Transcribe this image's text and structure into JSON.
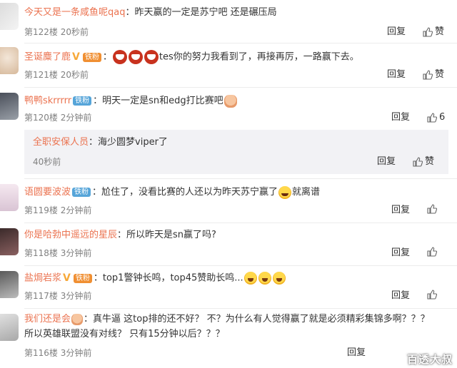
{
  "actions": {
    "reply": "回复",
    "like": "赞"
  },
  "comments": [
    {
      "user": "今天又是一条咸鱼呢qaq",
      "text": "昨天赢的一定是苏宁吧 还是碾压局",
      "floor": "第122楼",
      "time": "20秒前",
      "likes": ""
    },
    {
      "user": "圣诞麋了鹿",
      "badge": "铁粉",
      "text": "tes你的努力我看到了，再接再厉，一路赢下去。",
      "floor": "第121楼",
      "time": "20秒前",
      "likes": ""
    },
    {
      "user": "鸭鸭skrrrrr",
      "badge": "铁粉",
      "text": "明天一定是sn和edg打比赛吧",
      "floor": "第120楼",
      "time": "2分钟前",
      "likes": "6"
    },
    {
      "user": "语圆要波波",
      "badge": "铁粉",
      "text": "尬住了，没看比赛的人还以为昨天苏宁赢了",
      "text2": "就离谱",
      "floor": "第119楼",
      "time": "2分钟前",
      "likes": ""
    },
    {
      "user": "你是哈勃中遥远的星辰",
      "text": "所以昨天是sn赢了吗?",
      "floor": "第118楼",
      "time": "3分钟前",
      "likes": ""
    },
    {
      "user": "盐焗岩浆",
      "badge": "铁粉",
      "text": "top1警钟长鸣，top45赞助长鸣...",
      "floor": "第117楼",
      "time": "3分钟前",
      "likes": ""
    },
    {
      "user": "我们还是会",
      "text": "真牛逼 这top排的还不好？ 不？为什么有人觉得赢了就是必须精彩集锦多啊？？？",
      "text2": "所以英雄联盟没有对线？ 只有15分钟以后？？？",
      "floor": "第116楼",
      "time": "3分钟前",
      "likes": ""
    }
  ],
  "sub_reply": {
    "user": "全职安保人员",
    "text": "海少圆梦viper了",
    "time": "40秒前"
  },
  "watermark": "百透大叔",
  "colors": {
    "username": "#eb7350",
    "meta": "#808080",
    "badge": "#56a5d9",
    "sub_bg": "#f2f2f5"
  }
}
